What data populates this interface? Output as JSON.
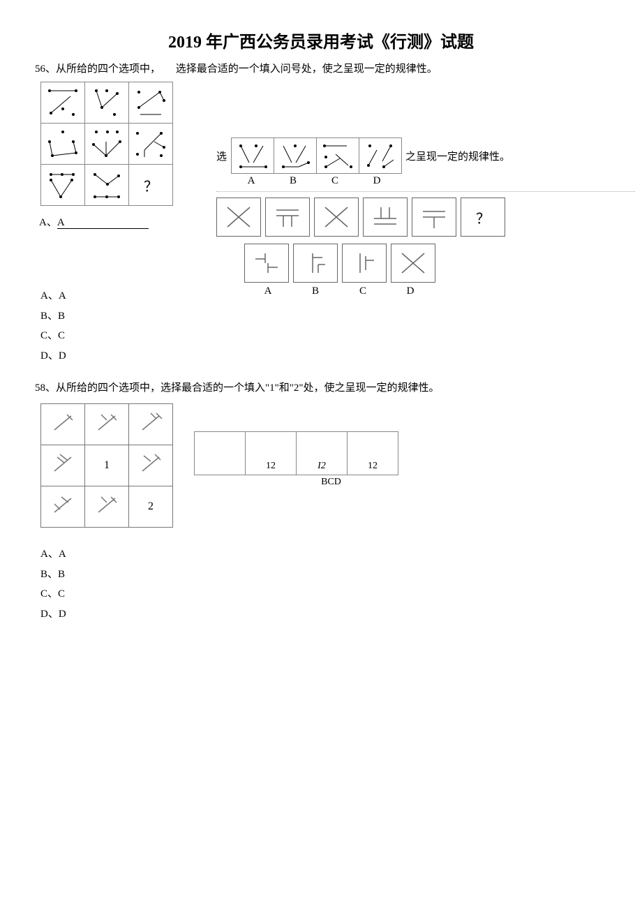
{
  "title": "2019 年广西公务员录用考试《行测》试题",
  "q56": {
    "num": "56、从所给的四个选项中，",
    "stem_right": "选择最合适的一个填入问号处，使之呈现一定的规律性。",
    "qmark": "？",
    "opt_prefix": "选",
    "opt_suffix": "之呈现一定的规律性。",
    "opt_labels": [
      "A",
      "B",
      "C",
      "D"
    ],
    "a_line": "A、",
    "a_under": "A"
  },
  "q57": {
    "qmark": "？",
    "opt_labels": [
      "A",
      "B",
      "C",
      "D"
    ],
    "choices": [
      "A、A",
      "B、B",
      "C、C",
      "D、D"
    ]
  },
  "q58": {
    "stem": "58、从所给的四个选项中，选择最合适的一个填入\"1\"和\"2\"处，使之呈现一定的规律性。",
    "cell1": "1",
    "cell2": "2",
    "opts": [
      "",
      "12",
      "I2",
      "12"
    ],
    "opt_label": "BCD",
    "choices": [
      "A、A",
      "B、B",
      "C、C",
      "D、D"
    ]
  }
}
